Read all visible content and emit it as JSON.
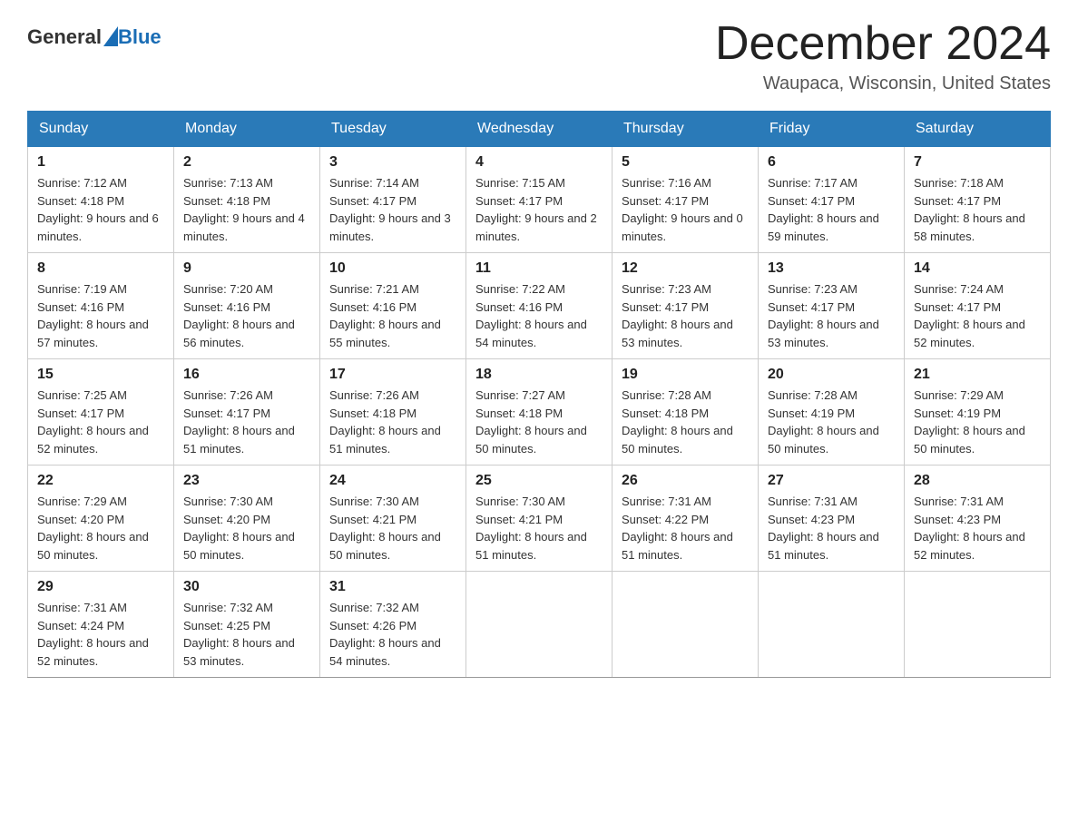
{
  "header": {
    "logo_text_general": "General",
    "logo_text_blue": "Blue",
    "month_title": "December 2024",
    "location": "Waupaca, Wisconsin, United States"
  },
  "weekdays": [
    "Sunday",
    "Monday",
    "Tuesday",
    "Wednesday",
    "Thursday",
    "Friday",
    "Saturday"
  ],
  "weeks": [
    [
      {
        "day": "1",
        "sunrise": "7:12 AM",
        "sunset": "4:18 PM",
        "daylight": "9 hours and 6 minutes."
      },
      {
        "day": "2",
        "sunrise": "7:13 AM",
        "sunset": "4:18 PM",
        "daylight": "9 hours and 4 minutes."
      },
      {
        "day": "3",
        "sunrise": "7:14 AM",
        "sunset": "4:17 PM",
        "daylight": "9 hours and 3 minutes."
      },
      {
        "day": "4",
        "sunrise": "7:15 AM",
        "sunset": "4:17 PM",
        "daylight": "9 hours and 2 minutes."
      },
      {
        "day": "5",
        "sunrise": "7:16 AM",
        "sunset": "4:17 PM",
        "daylight": "9 hours and 0 minutes."
      },
      {
        "day": "6",
        "sunrise": "7:17 AM",
        "sunset": "4:17 PM",
        "daylight": "8 hours and 59 minutes."
      },
      {
        "day": "7",
        "sunrise": "7:18 AM",
        "sunset": "4:17 PM",
        "daylight": "8 hours and 58 minutes."
      }
    ],
    [
      {
        "day": "8",
        "sunrise": "7:19 AM",
        "sunset": "4:16 PM",
        "daylight": "8 hours and 57 minutes."
      },
      {
        "day": "9",
        "sunrise": "7:20 AM",
        "sunset": "4:16 PM",
        "daylight": "8 hours and 56 minutes."
      },
      {
        "day": "10",
        "sunrise": "7:21 AM",
        "sunset": "4:16 PM",
        "daylight": "8 hours and 55 minutes."
      },
      {
        "day": "11",
        "sunrise": "7:22 AM",
        "sunset": "4:16 PM",
        "daylight": "8 hours and 54 minutes."
      },
      {
        "day": "12",
        "sunrise": "7:23 AM",
        "sunset": "4:17 PM",
        "daylight": "8 hours and 53 minutes."
      },
      {
        "day": "13",
        "sunrise": "7:23 AM",
        "sunset": "4:17 PM",
        "daylight": "8 hours and 53 minutes."
      },
      {
        "day": "14",
        "sunrise": "7:24 AM",
        "sunset": "4:17 PM",
        "daylight": "8 hours and 52 minutes."
      }
    ],
    [
      {
        "day": "15",
        "sunrise": "7:25 AM",
        "sunset": "4:17 PM",
        "daylight": "8 hours and 52 minutes."
      },
      {
        "day": "16",
        "sunrise": "7:26 AM",
        "sunset": "4:17 PM",
        "daylight": "8 hours and 51 minutes."
      },
      {
        "day": "17",
        "sunrise": "7:26 AM",
        "sunset": "4:18 PM",
        "daylight": "8 hours and 51 minutes."
      },
      {
        "day": "18",
        "sunrise": "7:27 AM",
        "sunset": "4:18 PM",
        "daylight": "8 hours and 50 minutes."
      },
      {
        "day": "19",
        "sunrise": "7:28 AM",
        "sunset": "4:18 PM",
        "daylight": "8 hours and 50 minutes."
      },
      {
        "day": "20",
        "sunrise": "7:28 AM",
        "sunset": "4:19 PM",
        "daylight": "8 hours and 50 minutes."
      },
      {
        "day": "21",
        "sunrise": "7:29 AM",
        "sunset": "4:19 PM",
        "daylight": "8 hours and 50 minutes."
      }
    ],
    [
      {
        "day": "22",
        "sunrise": "7:29 AM",
        "sunset": "4:20 PM",
        "daylight": "8 hours and 50 minutes."
      },
      {
        "day": "23",
        "sunrise": "7:30 AM",
        "sunset": "4:20 PM",
        "daylight": "8 hours and 50 minutes."
      },
      {
        "day": "24",
        "sunrise": "7:30 AM",
        "sunset": "4:21 PM",
        "daylight": "8 hours and 50 minutes."
      },
      {
        "day": "25",
        "sunrise": "7:30 AM",
        "sunset": "4:21 PM",
        "daylight": "8 hours and 51 minutes."
      },
      {
        "day": "26",
        "sunrise": "7:31 AM",
        "sunset": "4:22 PM",
        "daylight": "8 hours and 51 minutes."
      },
      {
        "day": "27",
        "sunrise": "7:31 AM",
        "sunset": "4:23 PM",
        "daylight": "8 hours and 51 minutes."
      },
      {
        "day": "28",
        "sunrise": "7:31 AM",
        "sunset": "4:23 PM",
        "daylight": "8 hours and 52 minutes."
      }
    ],
    [
      {
        "day": "29",
        "sunrise": "7:31 AM",
        "sunset": "4:24 PM",
        "daylight": "8 hours and 52 minutes."
      },
      {
        "day": "30",
        "sunrise": "7:32 AM",
        "sunset": "4:25 PM",
        "daylight": "8 hours and 53 minutes."
      },
      {
        "day": "31",
        "sunrise": "7:32 AM",
        "sunset": "4:26 PM",
        "daylight": "8 hours and 54 minutes."
      },
      null,
      null,
      null,
      null
    ]
  ]
}
